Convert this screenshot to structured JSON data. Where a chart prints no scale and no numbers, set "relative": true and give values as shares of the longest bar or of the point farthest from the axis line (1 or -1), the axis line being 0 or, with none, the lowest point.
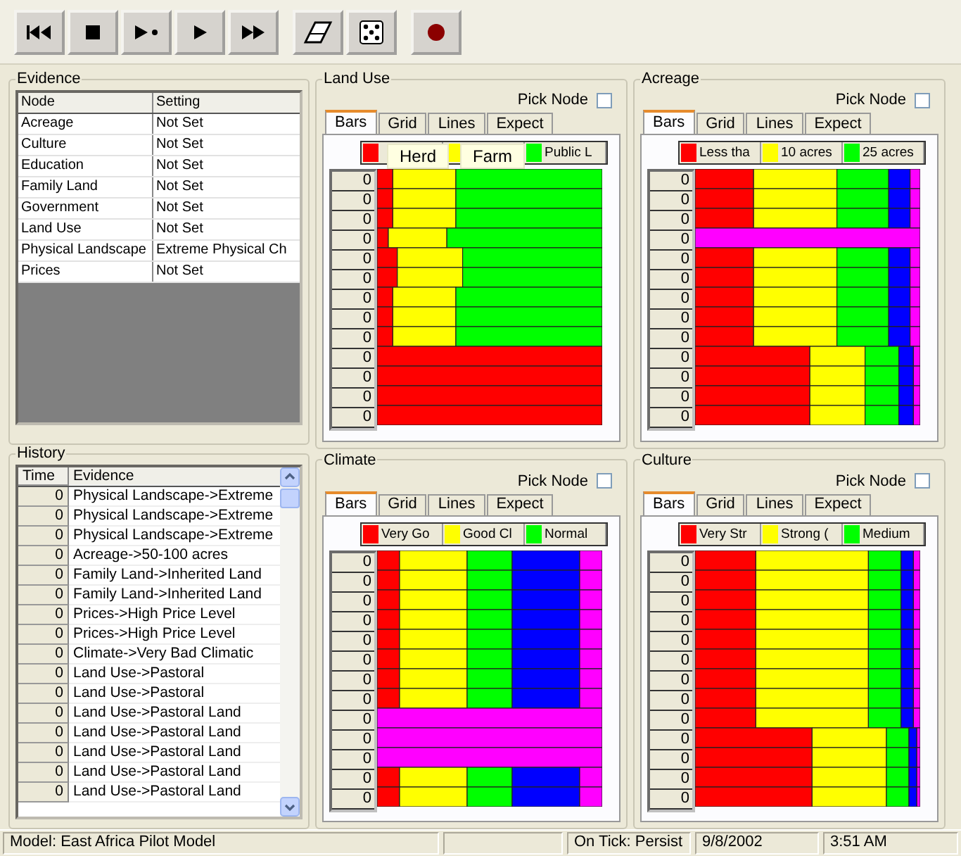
{
  "toolbar": {
    "groups": [
      {
        "buttons": [
          {
            "kind": "first"
          },
          {
            "kind": "stop"
          },
          {
            "kind": "step"
          },
          {
            "kind": "play"
          },
          {
            "kind": "fast-forward"
          }
        ]
      },
      {
        "buttons": [
          {
            "kind": "eraser"
          },
          {
            "kind": "dice"
          }
        ]
      },
      {
        "buttons": [
          {
            "kind": "record"
          }
        ]
      }
    ]
  },
  "evidence": {
    "title": "Evidence",
    "columns": [
      "Node",
      "Setting"
    ],
    "rows": [
      [
        "Acreage",
        "Not Set"
      ],
      [
        "Culture",
        "Not Set"
      ],
      [
        "Education",
        "Not Set"
      ],
      [
        "Family Land",
        "Not Set"
      ],
      [
        "Government",
        "Not Set"
      ],
      [
        "Land Use",
        "Not Set"
      ],
      [
        "Physical Landscape",
        "Extreme Physical Ch"
      ],
      [
        "Prices",
        "Not Set"
      ]
    ]
  },
  "history": {
    "title": "History",
    "columns": [
      "Time",
      "Evidence"
    ],
    "rows": [
      {
        "time": "0",
        "evidence": "Physical Landscape->Extreme"
      },
      {
        "time": "0",
        "evidence": "Physical Landscape->Extreme"
      },
      {
        "time": "0",
        "evidence": "Physical Landscape->Extreme"
      },
      {
        "time": "0",
        "evidence": "Acreage->50-100 acres"
      },
      {
        "time": "0",
        "evidence": "Family Land->Inherited Land"
      },
      {
        "time": "0",
        "evidence": "Family Land->Inherited Land"
      },
      {
        "time": "0",
        "evidence": "Prices->High Price Level"
      },
      {
        "time": "0",
        "evidence": "Prices->High Price Level"
      },
      {
        "time": "0",
        "evidence": "Climate->Very Bad Climatic"
      },
      {
        "time": "0",
        "evidence": "Land Use->Pastoral"
      },
      {
        "time": "0",
        "evidence": "Land Use->Pastoral"
      },
      {
        "time": "0",
        "evidence": "Land Use->Pastoral Land"
      },
      {
        "time": "0",
        "evidence": "Land Use->Pastoral Land"
      },
      {
        "time": "0",
        "evidence": "Land Use->Pastoral Land"
      },
      {
        "time": "0",
        "evidence": "Land Use->Pastoral Land"
      },
      {
        "time": "0",
        "evidence": "Land Use->Pastoral Land"
      }
    ]
  },
  "panels": [
    {
      "title": "Land Use",
      "pick_node": {
        "label": "Pick Node",
        "checked": false
      },
      "tabs": [
        {
          "label": "Bars",
          "selected": true
        },
        {
          "label": "Grid",
          "selected": false
        },
        {
          "label": "Lines",
          "selected": false
        },
        {
          "label": "Expect",
          "selected": false
        }
      ],
      "tooltips": [
        "Herd",
        "Farm"
      ],
      "chart_data": {
        "type": "bar",
        "orientation": "horizontal",
        "stacked": true,
        "relative": true,
        "legend": "top",
        "categories": [
          "0",
          "0",
          "0",
          "0",
          "0",
          "0",
          "0",
          "0",
          "0",
          "0",
          "0",
          "0",
          "0"
        ],
        "series": [
          {
            "color": "#ff0000",
            "values": [
              0.07,
              0.07,
              0.07,
              0.05,
              0.09,
              0.09,
              0.07,
              0.07,
              0.07,
              1,
              1,
              1,
              1
            ]
          },
          {
            "color": "#ffff00",
            "values": [
              0.28,
              0.28,
              0.28,
              0.26,
              0.29,
              0.29,
              0.28,
              0.28,
              0.28,
              0,
              0,
              0,
              0
            ]
          },
          {
            "name": "Public L",
            "color": "#00ff00",
            "values": [
              0.65,
              0.65,
              0.65,
              0.69,
              0.62,
              0.62,
              0.65,
              0.65,
              0.65,
              0,
              0,
              0,
              0
            ]
          }
        ]
      }
    },
    {
      "title": "Acreage",
      "pick_node": {
        "label": "Pick Node",
        "checked": false
      },
      "tabs": [
        {
          "label": "Bars",
          "selected": true
        },
        {
          "label": "Grid",
          "selected": false
        },
        {
          "label": "Lines",
          "selected": false
        },
        {
          "label": "Expect",
          "selected": false
        }
      ],
      "chart_data": {
        "type": "bar",
        "orientation": "horizontal",
        "stacked": true,
        "relative": true,
        "legend": "top",
        "categories": [
          "0",
          "0",
          "0",
          "0",
          "0",
          "0",
          "0",
          "0",
          "0",
          "0",
          "0",
          "0",
          "0"
        ],
        "series": [
          {
            "name": "Less tha",
            "color": "#ff0000",
            "values": [
              0.26,
              0.26,
              0.26,
              0,
              0.26,
              0.26,
              0.26,
              0.26,
              0.26,
              0.51,
              0.51,
              0.51,
              0.51
            ]
          },
          {
            "name": "10 acres",
            "color": "#ffff00",
            "values": [
              0.37,
              0.37,
              0.37,
              0,
              0.37,
              0.37,
              0.37,
              0.37,
              0.37,
              0.245,
              0.245,
              0.245,
              0.245
            ]
          },
          {
            "name": "25 acres",
            "color": "#00ff00",
            "values": [
              0.23,
              0.23,
              0.23,
              0,
              0.23,
              0.23,
              0.23,
              0.23,
              0.23,
              0.15,
              0.15,
              0.15,
              0.15
            ]
          },
          {
            "color": "#0000ff",
            "values": [
              0.095,
              0.095,
              0.095,
              0,
              0.095,
              0.095,
              0.095,
              0.095,
              0.095,
              0.065,
              0.065,
              0.065,
              0.065
            ]
          },
          {
            "color": "#ff00ff",
            "values": [
              0.045,
              0.045,
              0.045,
              1,
              0.045,
              0.045,
              0.045,
              0.045,
              0.045,
              0.03,
              0.03,
              0.03,
              0.03
            ]
          }
        ]
      }
    },
    {
      "title": "Climate",
      "pick_node": {
        "label": "Pick Node",
        "checked": false
      },
      "tabs": [
        {
          "label": "Bars",
          "selected": true
        },
        {
          "label": "Grid",
          "selected": false
        },
        {
          "label": "Lines",
          "selected": false
        },
        {
          "label": "Expect",
          "selected": false
        }
      ],
      "chart_data": {
        "type": "bar",
        "orientation": "horizontal",
        "stacked": true,
        "relative": true,
        "legend": "top",
        "categories": [
          "0",
          "0",
          "0",
          "0",
          "0",
          "0",
          "0",
          "0",
          "0",
          "0",
          "0",
          "0",
          "0"
        ],
        "series": [
          {
            "name": "Very Go",
            "color": "#ff0000",
            "values": [
              0.1,
              0.1,
              0.1,
              0.1,
              0.1,
              0.1,
              0.1,
              0.1,
              0,
              0,
              0,
              0.1,
              0.1
            ]
          },
          {
            "name": "Good Cl",
            "color": "#ffff00",
            "values": [
              0.3,
              0.3,
              0.3,
              0.3,
              0.3,
              0.3,
              0.3,
              0.3,
              0,
              0,
              0,
              0.3,
              0.3
            ]
          },
          {
            "name": "Normal",
            "color": "#00ff00",
            "values": [
              0.2,
              0.2,
              0.2,
              0.2,
              0.2,
              0.2,
              0.2,
              0.2,
              0,
              0,
              0,
              0.2,
              0.2
            ]
          },
          {
            "color": "#0000ff",
            "values": [
              0.3,
              0.3,
              0.3,
              0.3,
              0.3,
              0.3,
              0.3,
              0.3,
              0,
              0,
              0,
              0.3,
              0.3
            ]
          },
          {
            "color": "#ff00ff",
            "values": [
              0.1,
              0.1,
              0.1,
              0.1,
              0.1,
              0.1,
              0.1,
              0.1,
              1,
              1,
              1,
              0.1,
              0.1
            ]
          }
        ]
      }
    },
    {
      "title": "Culture",
      "pick_node": {
        "label": "Pick Node",
        "checked": false
      },
      "tabs": [
        {
          "label": "Bars",
          "selected": true
        },
        {
          "label": "Grid",
          "selected": false
        },
        {
          "label": "Lines",
          "selected": false
        },
        {
          "label": "Expect",
          "selected": false
        }
      ],
      "chart_data": {
        "type": "bar",
        "orientation": "horizontal",
        "stacked": true,
        "relative": true,
        "legend": "top",
        "categories": [
          "0",
          "0",
          "0",
          "0",
          "0",
          "0",
          "0",
          "0",
          "0",
          "0",
          "0",
          "0",
          "0"
        ],
        "series": [
          {
            "name": "Very Str",
            "color": "#ff0000",
            "values": [
              0.27,
              0.27,
              0.27,
              0.27,
              0.27,
              0.27,
              0.27,
              0.27,
              0.27,
              0.52,
              0.52,
              0.52,
              0.52
            ]
          },
          {
            "name": "Strong (",
            "color": "#ffff00",
            "values": [
              0.5,
              0.5,
              0.5,
              0.5,
              0.5,
              0.5,
              0.5,
              0.5,
              0.5,
              0.33,
              0.33,
              0.33,
              0.33
            ]
          },
          {
            "name": "Medium",
            "color": "#00ff00",
            "values": [
              0.145,
              0.145,
              0.145,
              0.145,
              0.145,
              0.145,
              0.145,
              0.145,
              0.145,
              0.1,
              0.1,
              0.1,
              0.1
            ]
          },
          {
            "color": "#0000ff",
            "values": [
              0.055,
              0.055,
              0.055,
              0.055,
              0.055,
              0.055,
              0.055,
              0.055,
              0.055,
              0.035,
              0.035,
              0.035,
              0.035
            ]
          },
          {
            "color": "#ff00ff",
            "values": [
              0.03,
              0.03,
              0.03,
              0.03,
              0.03,
              0.03,
              0.03,
              0.03,
              0.03,
              0.015,
              0.015,
              0.015,
              0.015
            ]
          }
        ]
      }
    }
  ],
  "status_bar": [
    {
      "kind": "text",
      "text": "Model: East Africa Pilot Model"
    },
    {
      "kind": "blank"
    },
    {
      "kind": "text",
      "text": "On Tick: Persist"
    },
    {
      "kind": "text",
      "text": "9/8/2002"
    },
    {
      "kind": "text",
      "text": "3:51 AM"
    }
  ]
}
